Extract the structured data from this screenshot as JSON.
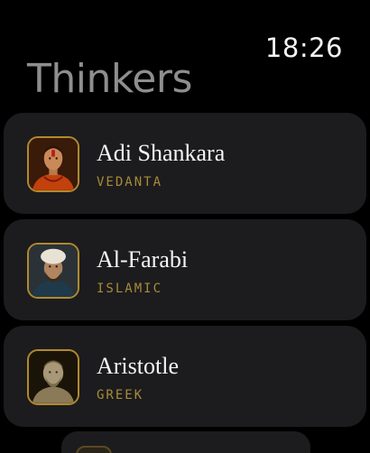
{
  "status": {
    "time": "18:26"
  },
  "header": {
    "title": "Thinkers"
  },
  "thinkers": [
    {
      "name": "Adi Shankara",
      "tradition": "VEDANTA",
      "portrait_icon": "adi-shankara-portrait"
    },
    {
      "name": "Al-Farabi",
      "tradition": "ISLAMIC",
      "portrait_icon": "al-farabi-portrait"
    },
    {
      "name": "Aristotle",
      "tradition": "GREEK",
      "portrait_icon": "aristotle-portrait"
    }
  ],
  "colors": {
    "card": "#1c1c1e",
    "accent": "#a88a3a",
    "title": "#8e8e8e"
  }
}
